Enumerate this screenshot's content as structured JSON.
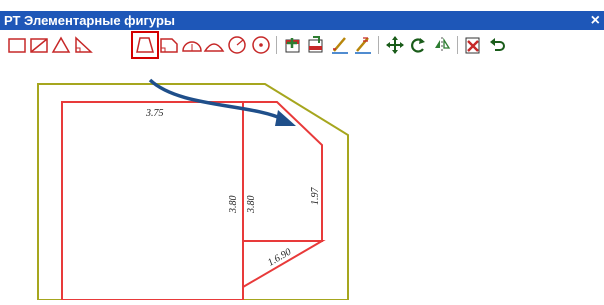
{
  "window": {
    "title": "РТ Элементарные фигуры",
    "close_glyph": "×"
  },
  "toolbar": {
    "groups": [
      [
        "rectangle-icon",
        "diagonal-rectangle-icon",
        "triangle-icon",
        "right-triangle-icon",
        "trapezoid-icon",
        "quarter-rect-icon",
        "semicircle-marked-icon",
        "segment-icon",
        "circle-arc-icon",
        "circle-center-icon"
      ],
      [
        "add-shape-icon",
        "remove-shape-icon",
        "edit-shape-icon",
        "edit-shape-alt-icon"
      ],
      [
        "move-icon",
        "rotate-icon",
        "mirror-icon"
      ],
      [
        "delete-icon",
        "undo-icon"
      ]
    ],
    "active_index": 4,
    "colors": {
      "shape": "#c62828",
      "highlight": "#d40000",
      "accent": "#1a3e7a"
    }
  },
  "drawing": {
    "labels": {
      "top": "3.75",
      "left_mid": "3.80",
      "right_mid": "3.80",
      "right_side": "1.97",
      "bottom": "1.6.90"
    },
    "colors": {
      "outline": "#a6a61e",
      "shape": "#e83a3a",
      "arrow": "#1f4f8a"
    }
  }
}
